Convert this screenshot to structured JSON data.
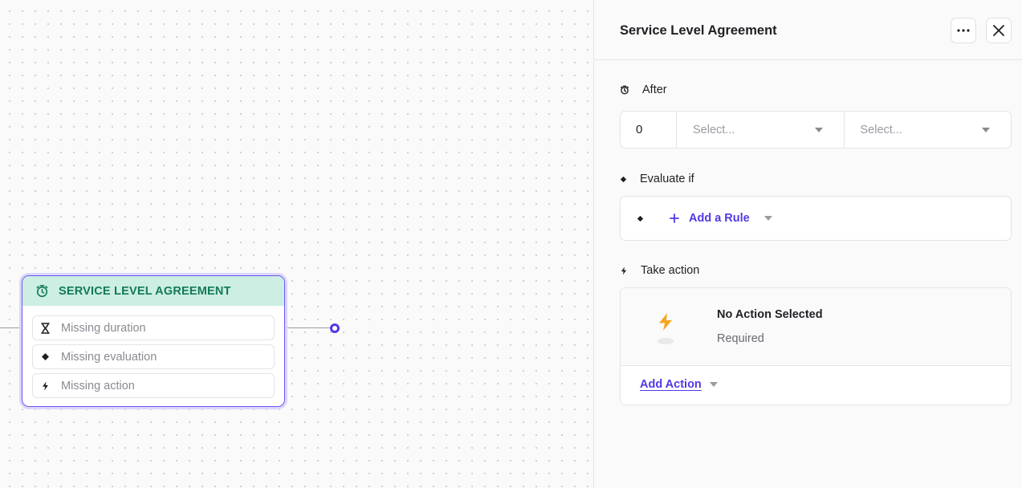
{
  "canvas": {
    "node": {
      "title": "SERVICE LEVEL AGREEMENT",
      "rows": [
        {
          "icon": "hourglass-icon",
          "label": "Missing duration"
        },
        {
          "icon": "diamond-icon",
          "label": "Missing evaluation"
        },
        {
          "icon": "sparkle-icon",
          "label": "Missing action"
        }
      ]
    }
  },
  "panel": {
    "title": "Service Level Agreement",
    "more_icon": "more-horizontal-icon",
    "close_icon": "close-icon",
    "after": {
      "label": "After",
      "value": "0",
      "select1_placeholder": "Select...",
      "select2_placeholder": "Select..."
    },
    "evaluate": {
      "label": "Evaluate if",
      "add_rule_label": "Add a Rule"
    },
    "action": {
      "label": "Take action",
      "empty_title": "No Action Selected",
      "empty_subtitle": "Required",
      "add_action_label": "Add Action"
    }
  },
  "colors": {
    "accent": "#4f3ae6",
    "node_header_bg": "#cdeee3",
    "node_title": "#127a57",
    "bolt": "#f5a623"
  }
}
